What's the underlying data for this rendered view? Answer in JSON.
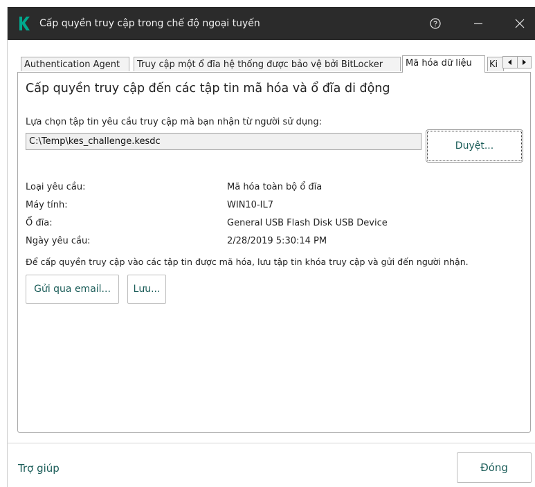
{
  "window": {
    "title": "Cấp quyền truy cập trong chế độ ngoại tuyến",
    "help_icon": "question-circle-icon",
    "minimize_icon": "minimize-icon",
    "close_icon": "close-icon",
    "logo_icon": "kaspersky-k-logo",
    "accent": "#00a88e",
    "titlebar_color": "#2b2b2b"
  },
  "tabs": [
    {
      "label": "Authentication Agent",
      "active": false
    },
    {
      "label": "Truy cập một ổ đĩa hệ thống được bảo vệ bởi BitLocker",
      "active": false
    },
    {
      "label": "Mã hóa dữ liệu",
      "active": true
    },
    {
      "label": "Ki",
      "active": false
    }
  ],
  "tab_scroll": {
    "left_icon": "triangle-left-icon",
    "right_icon": "triangle-right-icon"
  },
  "panel": {
    "heading": "Cấp quyền truy cập đến các tập tin mã hóa và ổ đĩa di động",
    "select_label": "Lựa chọn tập tin yêu cầu truy cập mà bạn nhận từ người sử dụng:",
    "file_path": "C:\\Temp\\kes_challenge.kesdc",
    "browse_label": "Duyệt...",
    "details": [
      {
        "label": "Loại yêu cầu:",
        "value": "Mã hóa toàn bộ ổ đĩa"
      },
      {
        "label": "Máy tính:",
        "value": "WIN10-IL7"
      },
      {
        "label": "Ổ đĩa:",
        "value": "General USB Flash Disk USB Device"
      },
      {
        "label": "Ngày yêu cầu:",
        "value": "2/28/2019 5:30:14 PM"
      }
    ],
    "instruction": "Để cấp quyền truy cập vào các tập tin được mã hóa, lưu tập tin khóa truy cập và gửi đến người nhận.",
    "email_label": "Gửi qua email...",
    "save_label": "Lưu..."
  },
  "footer": {
    "help_label": "Trợ giúp",
    "close_label": "Đóng",
    "link_color": "#1a5c58"
  }
}
